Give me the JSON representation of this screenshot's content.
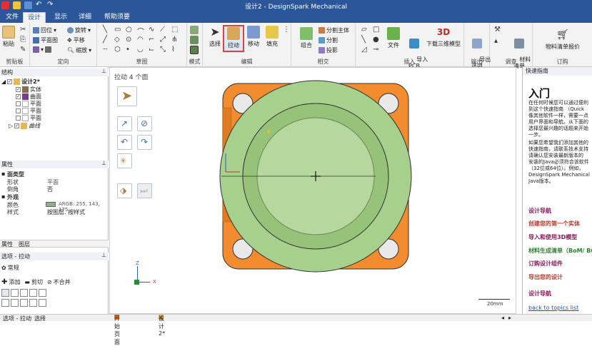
{
  "window": {
    "title": "设计2 - DesignSpark Mechanical"
  },
  "menu": {
    "tabs": [
      "文件",
      "设计",
      "显示",
      "详细",
      "帮助须要"
    ],
    "active_index": 1
  },
  "ribbon": {
    "clipboard": {
      "label": "剪贴板",
      "paste": "粘贴"
    },
    "orient": {
      "label": "定向",
      "items": [
        "回位",
        "旋转",
        "平面图",
        "平移",
        "缩放"
      ]
    },
    "sketch": {
      "label": "草图"
    },
    "mode": {
      "label": "模式"
    },
    "edit": {
      "label": "编辑",
      "select": "选择",
      "pull": "拉动",
      "move": "移动",
      "fill": "填充"
    },
    "intersect": {
      "label": "相交",
      "combine": "组合",
      "split_body": "分割主体",
      "split": "分割",
      "project": "投影"
    },
    "insert": {
      "label": "插入",
      "file": "文件",
      "import_pcb": "导入\nPCB",
      "download_3d": "下载三维模型",
      "logo_3d": "3D"
    },
    "output": {
      "label": "输出",
      "export": "导出\n选项"
    },
    "investigate": {
      "label": "调查",
      "material": "材料\n清单"
    },
    "order": {
      "label": "订购",
      "bom": "物料清单报价"
    }
  },
  "structure": {
    "header": "结构",
    "items": [
      {
        "label": "设计2*",
        "checked": true
      },
      {
        "label": "实体",
        "checked": true
      },
      {
        "label": "曲面",
        "checked": true
      },
      {
        "label": "平面",
        "checked": false
      },
      {
        "label": "平面",
        "checked": false
      },
      {
        "label": "平面",
        "checked": false
      },
      {
        "label": "曲线",
        "checked": true
      }
    ]
  },
  "properties": {
    "header": "属性",
    "group1": "面类型",
    "rows1": [
      {
        "k": "形状",
        "v": "平面"
      },
      {
        "k": "倒角",
        "v": "否"
      }
    ],
    "group2": "外观",
    "rows2": [
      {
        "k": "颜色",
        "v": "ARGB: 255, 143, 175"
      },
      {
        "k": "样式",
        "v": "按图层. 按样式"
      }
    ]
  },
  "panel_tabs": [
    "属性",
    "图层"
  ],
  "options": {
    "header": "选项 - 拉动",
    "section": "常规",
    "add": "添加",
    "cut": "剪切",
    "no_merge": "不合并"
  },
  "canvas": {
    "hint": "拉动 4 个面",
    "axes": {
      "z": "Z",
      "x": "X"
    },
    "scale": "20mm",
    "tabs": [
      "开始页面",
      "设计2*"
    ],
    "colors": {
      "frame": "#f28c2e",
      "body": "#a8d08d",
      "ring": "#97c27a",
      "inner": "#b6d89e"
    }
  },
  "status": {
    "left": "选项 - 拉动",
    "right": "选择"
  },
  "guide": {
    "header": "快速指南",
    "title": "入门",
    "paragraph": [
      "在任何时候您可以通过便利",
      "到这个快速指南 （Quick",
      "像其他软件一样，需要一点",
      "用户界面和导航。从下面的",
      "选择您最兴趣的话题来开始",
      "一步。",
      "如果您希望我们添加其他的",
      "快速指南，请联系技术支持",
      "请确认您安装最新版本的",
      "安装的Java必须符合该软件",
      "（32位或64位）。例如，",
      "DesignSpark Mechanical",
      "Java版本。"
    ],
    "links": [
      {
        "text": "设计导航",
        "color": "#8b1a5c"
      },
      {
        "text": "创建您的第一个实体",
        "color": "#c0392b"
      },
      {
        "text": "导入和使用3D模型",
        "color": "#8b1a5c"
      },
      {
        "text": "材料生成清单（BoM/ BO",
        "color": "#2e7d32"
      },
      {
        "text": "订购设计组件",
        "color": "#8b1a5c"
      },
      {
        "text": "导出您的设计",
        "color": "#c0392b"
      },
      {
        "text": "设计导航",
        "color": "#8b1a5c"
      }
    ],
    "back": "back to topics list"
  }
}
